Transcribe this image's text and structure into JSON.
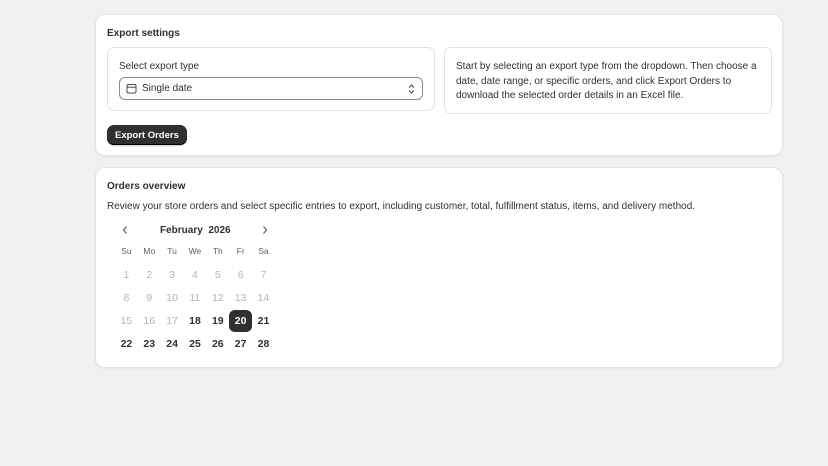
{
  "export_settings": {
    "title": "Export settings",
    "field_label": "Select export type",
    "selected_type": "Single date",
    "help_text": "Start by selecting an export type from the dropdown. Then choose a date, date range, or specific orders, and click Export Orders to download the selected order details in an Excel file.",
    "export_button": "Export Orders"
  },
  "orders_overview": {
    "title": "Orders overview",
    "description": "Review your store orders and select specific entries to export, including customer, total, fulfillment status, items, and delivery method.",
    "calendar": {
      "month_label": "February  2026",
      "prev_icon": "chevron-left-icon",
      "next_icon": "chevron-right-icon",
      "weekdays": [
        "Su",
        "Mo",
        "Tu",
        "We",
        "Th",
        "Fr",
        "Sa"
      ],
      "weeks": [
        [
          {
            "d": "1",
            "s": "disabled"
          },
          {
            "d": "2",
            "s": "disabled"
          },
          {
            "d": "3",
            "s": "disabled"
          },
          {
            "d": "4",
            "s": "disabled"
          },
          {
            "d": "5",
            "s": "disabled"
          },
          {
            "d": "6",
            "s": "disabled"
          },
          {
            "d": "7",
            "s": "disabled"
          }
        ],
        [
          {
            "d": "8",
            "s": "disabled"
          },
          {
            "d": "9",
            "s": "disabled"
          },
          {
            "d": "10",
            "s": "disabled"
          },
          {
            "d": "11",
            "s": "disabled"
          },
          {
            "d": "12",
            "s": "disabled"
          },
          {
            "d": "13",
            "s": "disabled"
          },
          {
            "d": "14",
            "s": "disabled"
          }
        ],
        [
          {
            "d": "15",
            "s": "disabled"
          },
          {
            "d": "16",
            "s": "disabled"
          },
          {
            "d": "17",
            "s": "disabled"
          },
          {
            "d": "18",
            "s": "enabled"
          },
          {
            "d": "19",
            "s": "enabled"
          },
          {
            "d": "20",
            "s": "selected"
          },
          {
            "d": "21",
            "s": "enabled"
          }
        ],
        [
          {
            "d": "22",
            "s": "enabled"
          },
          {
            "d": "23",
            "s": "enabled"
          },
          {
            "d": "24",
            "s": "enabled"
          },
          {
            "d": "25",
            "s": "enabled"
          },
          {
            "d": "26",
            "s": "enabled"
          },
          {
            "d": "27",
            "s": "enabled"
          },
          {
            "d": "28",
            "s": "enabled"
          }
        ]
      ]
    }
  },
  "colors": {
    "background": "#f1f1f1",
    "card": "#ffffff",
    "primary_button": "#303030",
    "selected_day": "#303030",
    "disabled_day": "#b5b5b5"
  }
}
